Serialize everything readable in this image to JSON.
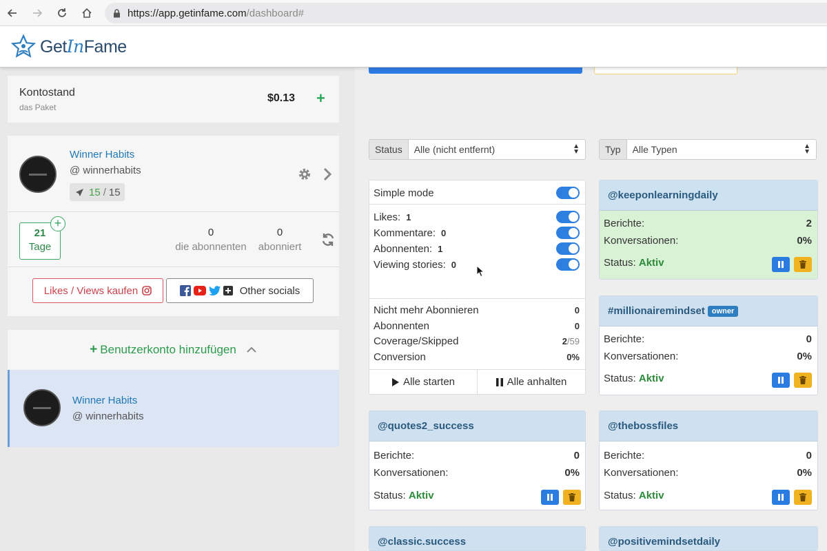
{
  "browser": {
    "url_host": "https://app.getinfame.com",
    "url_path": "/dashboard#"
  },
  "header": {
    "logo_part1": "Get",
    "logo_part2": "In",
    "logo_part3": "Fame"
  },
  "balance": {
    "title": "Kontostand",
    "subtitle": "das Paket",
    "amount": "$0.13",
    "add": "+"
  },
  "account": {
    "name": "Winner Habits",
    "handle": "@ winnerhabits",
    "actions_used": "15",
    "actions_sep": "/",
    "actions_total": "15",
    "days_value": "21",
    "days_label": "Tage",
    "subscribers_value": "0",
    "subscribers_label": "die abonnenten",
    "subscribed_value": "0",
    "subscribed_label": "abonniert",
    "buy_label": "Likes / Views kaufen",
    "other_socials": "Other socials"
  },
  "add_account": {
    "label": "Benutzerkonto hinzufügen",
    "plus": "+"
  },
  "selected_account": {
    "name": "Winner Habits",
    "handle": "@ winnerhabits"
  },
  "filters": {
    "status_label": "Status",
    "status_value": "Alle (nicht entfernt)",
    "type_label": "Typ",
    "type_value": "Alle Typen"
  },
  "settings": {
    "simple_mode": "Simple mode",
    "likes_label": "Likes:",
    "likes_value": "1",
    "comments_label": "Kommentare:",
    "comments_value": "0",
    "followers_label": "Abonnenten:",
    "followers_value": "1",
    "stories_label": "Viewing stories:",
    "stories_value": "0",
    "unfollow_label": "Nicht mehr Abonnieren",
    "unfollow_value": "0",
    "subs_label": "Abonnenten",
    "subs_value": "0",
    "coverage_label": "Coverage/Skipped",
    "coverage_value": "2",
    "coverage_total": "/59",
    "conversion_label": "Conversion",
    "conversion_value": "0%",
    "start_all": "Alle starten",
    "pause_all": "Alle anhalten"
  },
  "labels": {
    "reports": "Berichte:",
    "conversations": "Konversationen:",
    "status": "Status:",
    "active": "Aktiv",
    "owner": "owner"
  },
  "cards": [
    {
      "title": "@keeponlearningdaily",
      "reports": "2",
      "conversations": "0%"
    },
    {
      "title": "#millionairemindset",
      "reports": "0",
      "conversations": "0%"
    },
    {
      "title": "@quotes2_success",
      "reports": "0",
      "conversations": "0%"
    },
    {
      "title": "@thebossfiles",
      "reports": "0",
      "conversations": "0%"
    },
    {
      "title": "@classic.success"
    },
    {
      "title": "@positivemindsetdaily"
    }
  ],
  "colors": {
    "brand_blue": "#2f7fc0",
    "accent_green": "#2d9a4e",
    "toggle_blue": "#2d7fe0",
    "trash_yellow": "#f0b220"
  }
}
